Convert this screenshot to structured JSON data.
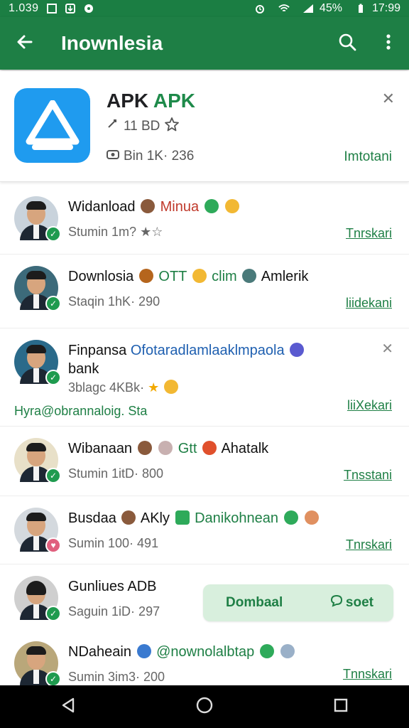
{
  "status_bar": {
    "time_left": "1.039",
    "battery": "45%",
    "time_right": "17:99"
  },
  "app_bar": {
    "title": "Inownlesia",
    "back_icon": "arrow-left-icon",
    "search_icon": "search-icon",
    "more_icon": "more-vert-icon",
    "color": "#1e7f45"
  },
  "featured": {
    "name_main": "APK",
    "name_accent": "APK",
    "meta": "11 BD",
    "stats": "Bin 1K· 236",
    "install_label": "Imtotani",
    "close_label": "✕",
    "icon_color": "#1f9bef"
  },
  "rows": [
    {
      "title": "Widanload",
      "title_extra": "Minua",
      "sub": "Stumin 1m?",
      "link": "Tnrskari"
    },
    {
      "title": "Downlosia",
      "title_extra": "OTT",
      "title_extra2": "clim",
      "title_extra3": "Amlerik",
      "sub": "Staqin 1hK· 290",
      "link": "liidekani"
    },
    {
      "title": "Finpansa",
      "title_extra": "Ofotaradlamlaaklmpaola",
      "title_line2": "bank",
      "sub": "3blagc 4KBk·",
      "extra_line": "Hyra@obrannaloig. Sta",
      "link": "liiXekari",
      "close": "✕"
    },
    {
      "title": "Wibanaan",
      "title_extra": "Gtt",
      "title_extra2": "Ahatalk",
      "sub": "Stumin 1itD· 800",
      "link": "Tnsstani"
    },
    {
      "title": "Busdaa",
      "title_extra": "AKly",
      "title_extra2": "Danikohnean",
      "sub": "Sumin 100· 491",
      "link": "Tnrskari"
    },
    {
      "title": "Gunliues ADB",
      "sub": "Saguin 1iD· 297",
      "link": ""
    },
    {
      "title": "NDaheain",
      "title_extra": "@nownolalbtap",
      "sub": "Sumin 3im3· 200",
      "link": "Tnnskari"
    }
  ],
  "snackbar": {
    "action_left": "Dombaal",
    "action_right": "soet"
  },
  "nav": {
    "back": "nav-back-icon",
    "home": "nav-home-icon",
    "recents": "nav-recents-icon"
  }
}
